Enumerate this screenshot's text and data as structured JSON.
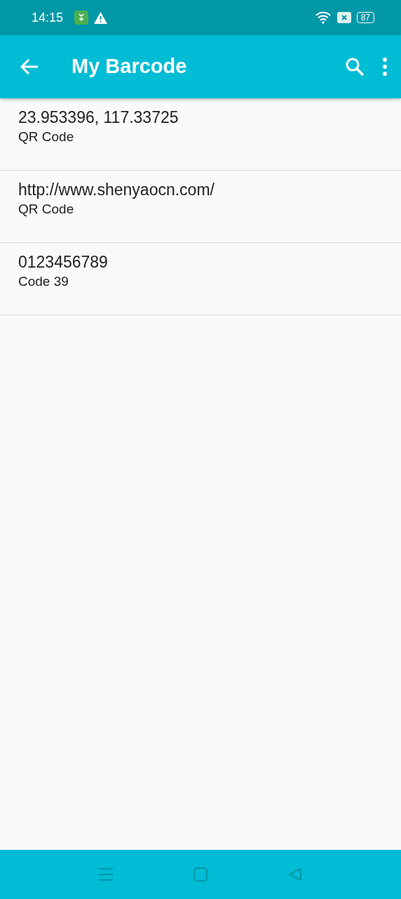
{
  "status_bar": {
    "time": "14:15",
    "battery": "87"
  },
  "app_bar": {
    "title": "My Barcode"
  },
  "barcodes": [
    {
      "value": "23.953396, 117.33725",
      "format": "QR Code"
    },
    {
      "value": "http://www.shenyaocn.com/",
      "format": "QR Code"
    },
    {
      "value": "0123456789",
      "format": "Code 39"
    }
  ]
}
